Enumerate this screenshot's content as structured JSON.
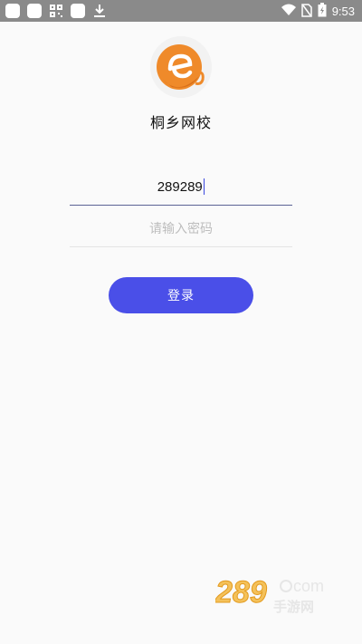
{
  "status_bar": {
    "time": "9:53",
    "icons": [
      "notification-square-icon",
      "notification-square-icon",
      "qr-icon",
      "notification-square-icon",
      "download-icon",
      "wifi-icon",
      "no-sim-icon",
      "battery-icon"
    ]
  },
  "app": {
    "name": "桐乡网校",
    "logo_letter": "e",
    "brand_color": "#ef8a2a"
  },
  "form": {
    "username_value": "289289",
    "password_placeholder": "请输入密码"
  },
  "login_button": {
    "label": "登录",
    "color": "#4a4fe8"
  },
  "watermark": {
    "number_text": "289",
    "com_text": "com",
    "cn_text": "手游网"
  }
}
